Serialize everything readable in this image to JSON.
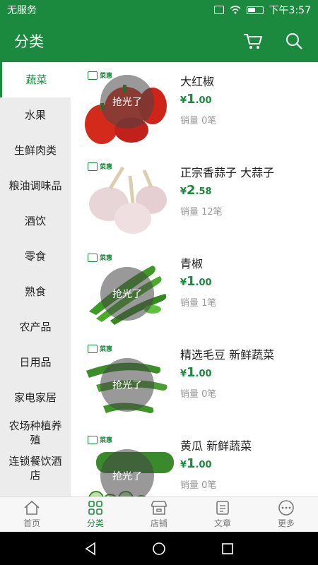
{
  "status_bar": {
    "carrier": "无服务",
    "time": "下午3:57"
  },
  "header": {
    "title": "分类",
    "cart_icon": "cart-icon",
    "search_icon": "search-icon"
  },
  "sidebar": {
    "items": [
      {
        "label": "蔬菜",
        "active": true
      },
      {
        "label": "水果"
      },
      {
        "label": "生鲜肉类"
      },
      {
        "label": "粮油调味品"
      },
      {
        "label": "酒饮"
      },
      {
        "label": "零食"
      },
      {
        "label": "熟食"
      },
      {
        "label": "农产品"
      },
      {
        "label": "日用品"
      },
      {
        "label": "家电家居"
      },
      {
        "label": "农场种植养殖"
      },
      {
        "label": "连锁餐饮酒店"
      }
    ]
  },
  "products": [
    {
      "name": "大红椒",
      "currency": "¥",
      "price_int": "1",
      "price_dec": ".00",
      "sales": "销量 0笔",
      "sold_out": "抢光了",
      "brand": "菜惠"
    },
    {
      "name": "正宗香蒜子 大蒜子",
      "currency": "¥",
      "price_int": "2",
      "price_dec": ".58",
      "sales": "销量 12笔",
      "sold_out": "",
      "brand": "菜惠"
    },
    {
      "name": "青椒",
      "currency": "¥",
      "price_int": "1",
      "price_dec": ".00",
      "sales": "销量 1笔",
      "sold_out": "抢光了",
      "brand": "菜惠"
    },
    {
      "name": "精选毛豆 新鲜蔬菜",
      "currency": "¥",
      "price_int": "1",
      "price_dec": ".00",
      "sales": "销量 0笔",
      "sold_out": "抢光了",
      "brand": "菜惠"
    },
    {
      "name": "黄瓜 新鲜蔬菜",
      "currency": "¥",
      "price_int": "1",
      "price_dec": ".00",
      "sales": "销量 0笔",
      "sold_out": "抢光了",
      "brand": "菜惠"
    }
  ],
  "bottom_nav": [
    {
      "label": "首页",
      "icon": "home-icon"
    },
    {
      "label": "分类",
      "icon": "category-icon",
      "active": true
    },
    {
      "label": "店铺",
      "icon": "store-icon"
    },
    {
      "label": "文章",
      "icon": "article-icon"
    },
    {
      "label": "更多",
      "icon": "more-icon"
    }
  ],
  "colors": {
    "primary": "#1b8a3e",
    "sidebar_bg": "#ececec"
  }
}
